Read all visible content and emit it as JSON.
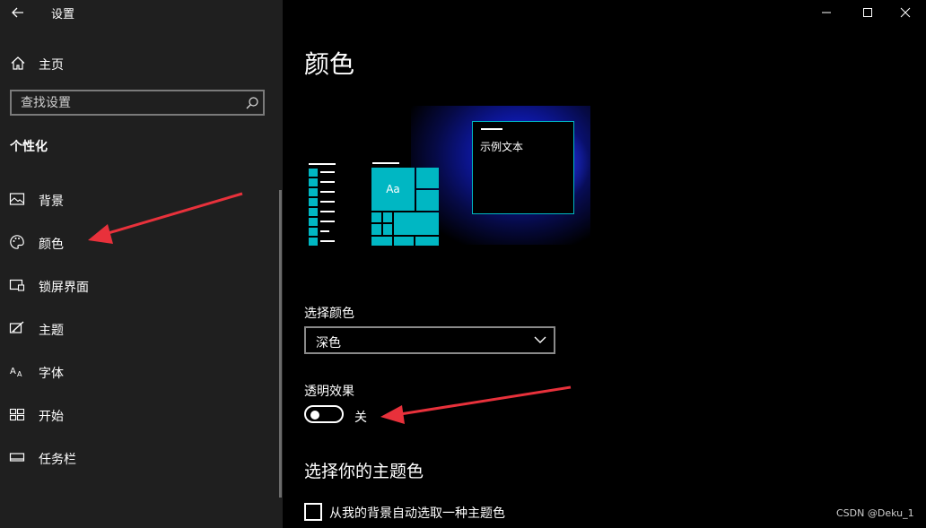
{
  "window": {
    "title": "设置"
  },
  "sidebar": {
    "home_label": "主页",
    "search_placeholder": "查找设置",
    "section_title": "个性化",
    "items": [
      {
        "label": "背景",
        "icon": "picture-icon"
      },
      {
        "label": "颜色",
        "icon": "palette-icon"
      },
      {
        "label": "锁屏界面",
        "icon": "lock-screen-icon"
      },
      {
        "label": "主题",
        "icon": "theme-icon"
      },
      {
        "label": "字体",
        "icon": "font-icon"
      },
      {
        "label": "开始",
        "icon": "start-icon"
      },
      {
        "label": "任务栏",
        "icon": "taskbar-icon"
      }
    ]
  },
  "main": {
    "page_title": "颜色",
    "preview": {
      "tile_text": "Aa",
      "sample_text": "示例文本"
    },
    "choose_color_label": "选择颜色",
    "choose_color_value": "深色",
    "transparency_label": "透明效果",
    "transparency_state": "关",
    "transparency_on": false,
    "accent_title": "选择你的主题色",
    "auto_accent_label": "从我的背景自动选取一种主题色",
    "auto_accent_checked": false
  },
  "colors": {
    "accent": "#00b7c3",
    "sidebar_bg": "#1f1f1f",
    "main_bg": "#000000",
    "annotation_arrow": "#e8313b"
  },
  "watermark": "CSDN @Deku_1"
}
